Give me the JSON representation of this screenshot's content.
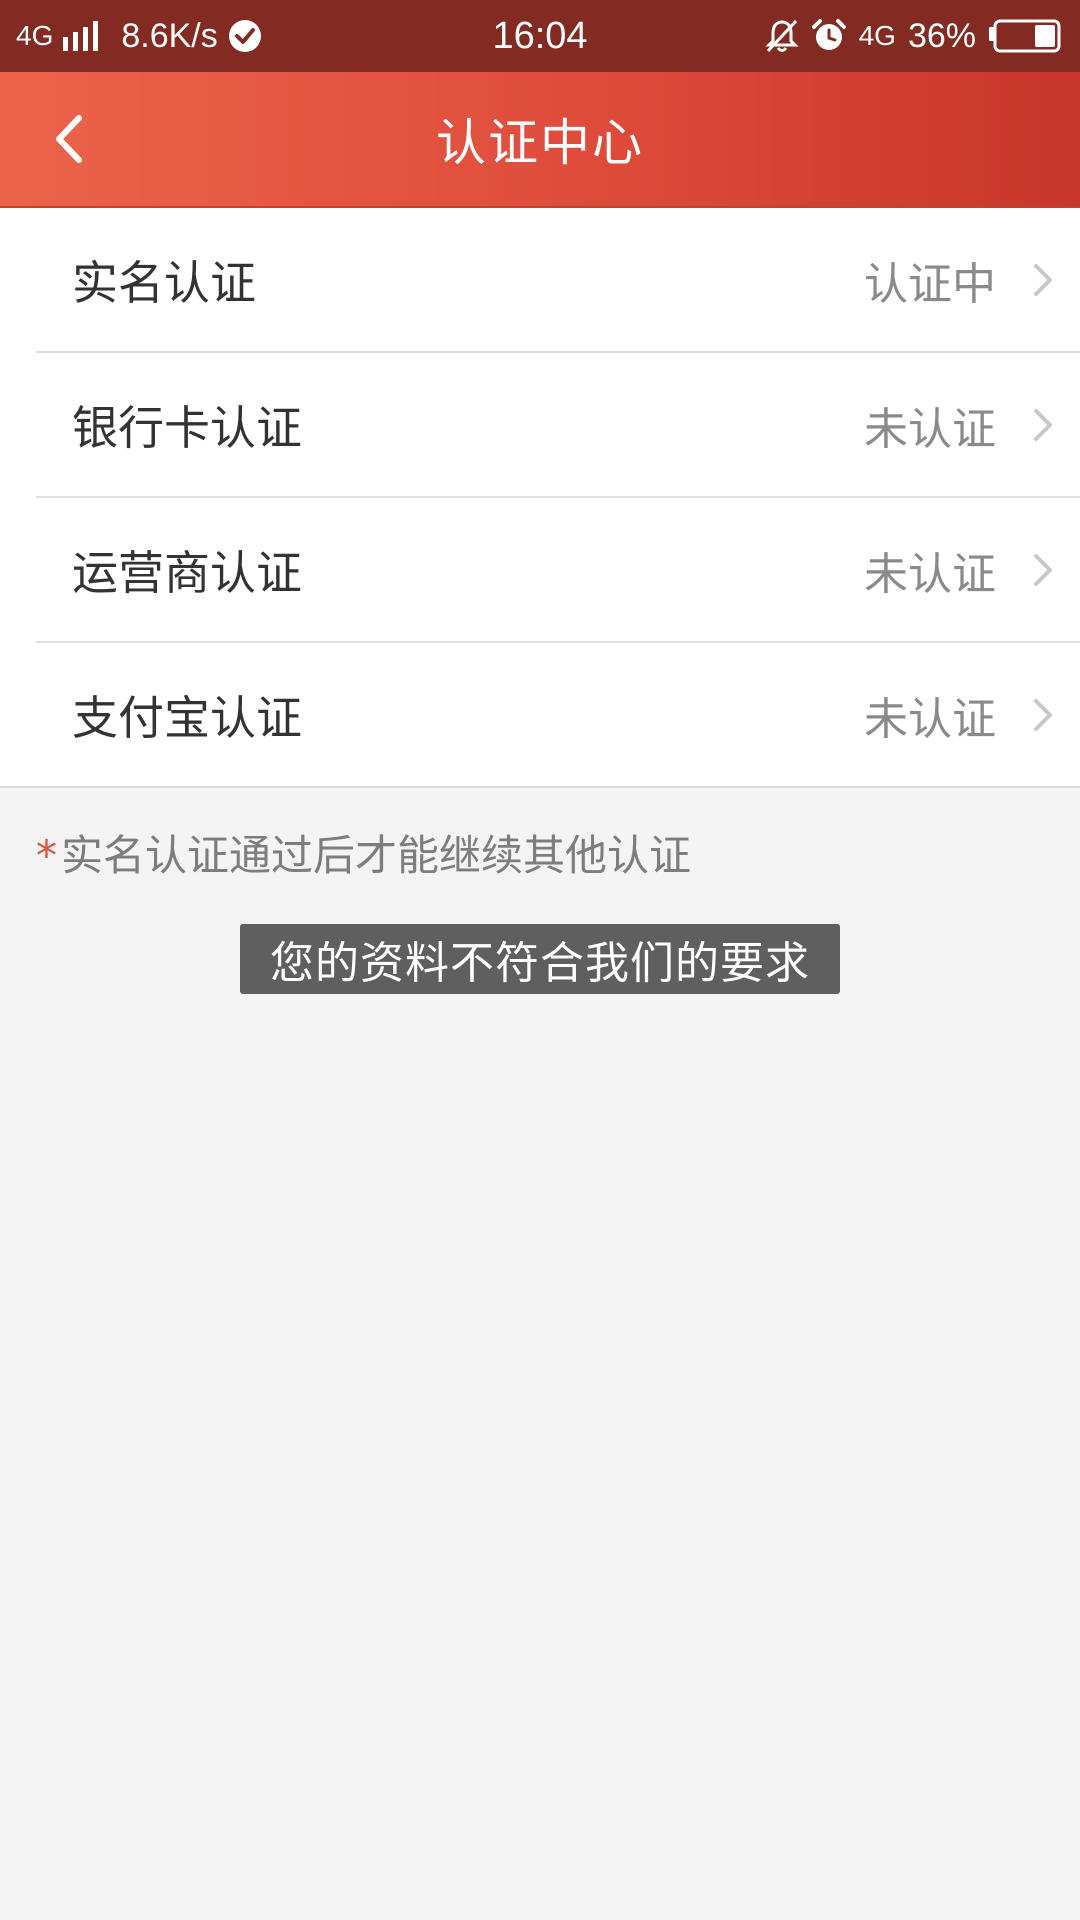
{
  "status_bar": {
    "network": "4G",
    "speed": "8.6K/s",
    "time": "16:04",
    "network_right": "4G",
    "battery_percent": "36%",
    "battery_level": 0.36,
    "icons": [
      "signal-bars-icon",
      "check-circle-icon",
      "bell-off-icon",
      "alarm-clock-icon",
      "battery-icon"
    ]
  },
  "header": {
    "title": "认证中心",
    "back_icon": "chevron-left-icon"
  },
  "list": {
    "items": [
      {
        "label": "实名认证",
        "status": "认证中"
      },
      {
        "label": "银行卡认证",
        "status": "未认证"
      },
      {
        "label": "运营商认证",
        "status": "未认证"
      },
      {
        "label": "支付宝认证",
        "status": "未认证"
      }
    ]
  },
  "note": {
    "asterisk": "*",
    "text": "实名认证通过后才能继续其他认证"
  },
  "toast": {
    "text": "您的资料不符合我们的要求"
  },
  "colors": {
    "header_start": "#ec634a",
    "header_end": "#c8352a",
    "status_bar": "#832b22",
    "asterisk": "#e0533e",
    "toast_bg": "#5f5f5f"
  }
}
